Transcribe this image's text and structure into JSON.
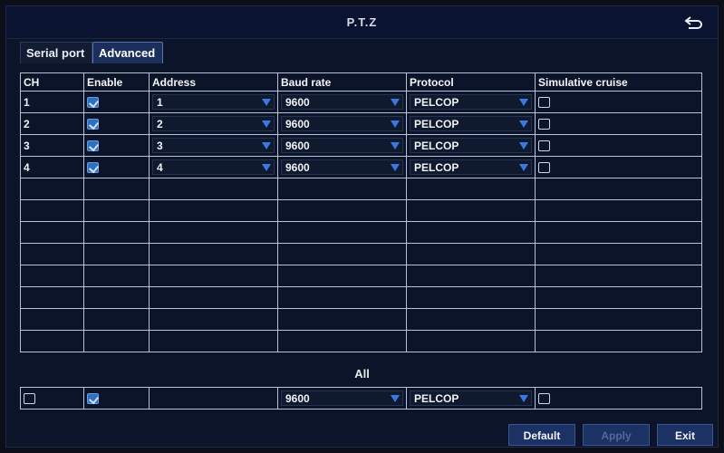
{
  "window": {
    "title": "P.T.Z"
  },
  "tabs": [
    {
      "label": "Serial port",
      "active": false
    },
    {
      "label": "Advanced",
      "active": true
    }
  ],
  "table": {
    "headers": [
      "CH",
      "Enable",
      "Address",
      "Baud rate",
      "Protocol",
      "Simulative cruise"
    ],
    "rows": [
      {
        "ch": "1",
        "enable": true,
        "address": "1",
        "baud": "9600",
        "protocol": "PELCOP",
        "cruise": false
      },
      {
        "ch": "2",
        "enable": true,
        "address": "2",
        "baud": "9600",
        "protocol": "PELCOP",
        "cruise": false
      },
      {
        "ch": "3",
        "enable": true,
        "address": "3",
        "baud": "9600",
        "protocol": "PELCOP",
        "cruise": false
      },
      {
        "ch": "4",
        "enable": true,
        "address": "4",
        "baud": "9600",
        "protocol": "PELCOP",
        "cruise": false
      }
    ],
    "empty_rows": 8
  },
  "all": {
    "label": "All",
    "select_all": false,
    "enable": true,
    "baud": "9600",
    "protocol": "PELCOP",
    "cruise": false
  },
  "buttons": {
    "default": "Default",
    "apply": "Apply",
    "exit": "Exit"
  },
  "colors": {
    "accent": "#3a78e0",
    "background": "#0b1428",
    "grid_line": "#b8c2d6"
  }
}
